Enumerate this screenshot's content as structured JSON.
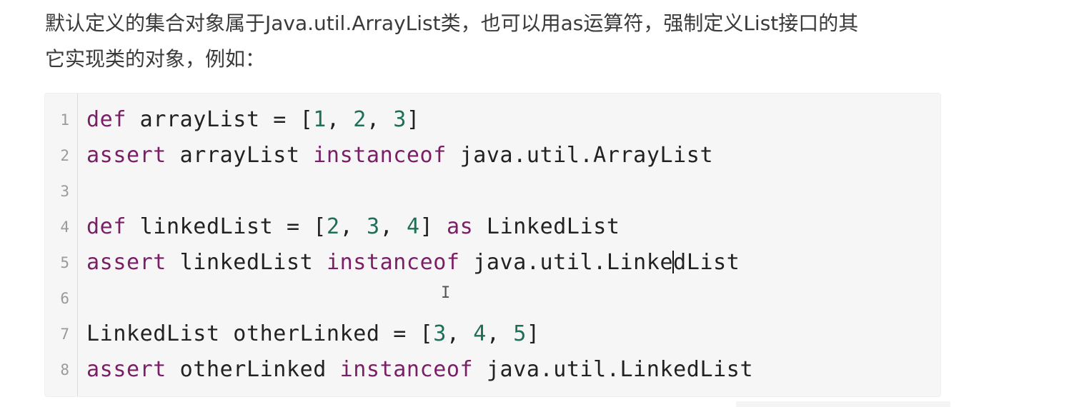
{
  "paragraph": {
    "line1": "默认定义的集合对象属于Java.util.ArrayList类，也可以用as运算符，强制定义List接口的其",
    "line2": "它实现类的对象，例如："
  },
  "code_block": {
    "line_numbers": [
      "1",
      "2",
      "3",
      "4",
      "5",
      "6",
      "7",
      "8"
    ],
    "lines": [
      {
        "tokens": [
          {
            "text": "def",
            "type": "keyword"
          },
          {
            "text": " arrayList = [",
            "type": "plain"
          },
          {
            "text": "1",
            "type": "number"
          },
          {
            "text": ", ",
            "type": "plain"
          },
          {
            "text": "2",
            "type": "number"
          },
          {
            "text": ", ",
            "type": "plain"
          },
          {
            "text": "3",
            "type": "number"
          },
          {
            "text": "]",
            "type": "plain"
          }
        ]
      },
      {
        "tokens": [
          {
            "text": "assert",
            "type": "keyword"
          },
          {
            "text": " arrayList ",
            "type": "plain"
          },
          {
            "text": "instanceof",
            "type": "keyword"
          },
          {
            "text": " java.util.ArrayList",
            "type": "plain"
          }
        ]
      },
      {
        "tokens": []
      },
      {
        "tokens": [
          {
            "text": "def",
            "type": "keyword"
          },
          {
            "text": " linkedList = [",
            "type": "plain"
          },
          {
            "text": "2",
            "type": "number"
          },
          {
            "text": ", ",
            "type": "plain"
          },
          {
            "text": "3",
            "type": "number"
          },
          {
            "text": ", ",
            "type": "plain"
          },
          {
            "text": "4",
            "type": "number"
          },
          {
            "text": "] ",
            "type": "plain"
          },
          {
            "text": "as",
            "type": "keyword"
          },
          {
            "text": " LinkedList",
            "type": "plain"
          }
        ]
      },
      {
        "tokens": [
          {
            "text": "assert",
            "type": "keyword"
          },
          {
            "text": " linkedList ",
            "type": "plain"
          },
          {
            "text": "instanceof",
            "type": "keyword"
          },
          {
            "text": " java.util.Linke",
            "type": "plain"
          },
          {
            "text": "",
            "type": "caret"
          },
          {
            "text": "dList",
            "type": "plain"
          }
        ]
      },
      {
        "tokens": []
      },
      {
        "tokens": [
          {
            "text": "LinkedList otherLinked = [",
            "type": "plain"
          },
          {
            "text": "3",
            "type": "number"
          },
          {
            "text": ", ",
            "type": "plain"
          },
          {
            "text": "4",
            "type": "number"
          },
          {
            "text": ", ",
            "type": "plain"
          },
          {
            "text": "5",
            "type": "number"
          },
          {
            "text": "]",
            "type": "plain"
          }
        ]
      },
      {
        "tokens": [
          {
            "text": "assert",
            "type": "keyword"
          },
          {
            "text": " otherLinked ",
            "type": "plain"
          },
          {
            "text": "instanceof",
            "type": "keyword"
          },
          {
            "text": " java.util.LinkedList",
            "type": "plain"
          }
        ]
      }
    ]
  },
  "colors": {
    "keyword": "#7a1f66",
    "number": "#1e6e58",
    "plain": "#222222",
    "line_number": "#9a9a9a",
    "code_background": "#f6f6f6"
  },
  "cursor": {
    "icon": "text-ibeam-icon",
    "glyph": "I"
  }
}
